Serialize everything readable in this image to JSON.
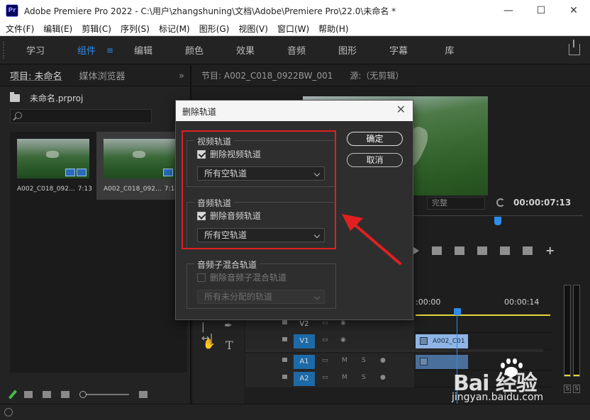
{
  "window": {
    "app_icon": "Pr",
    "title": "Adobe Premiere Pro 2022 - C:\\用户\\zhangshuning\\文档\\Adobe\\Premiere Pro\\22.0\\未命名 *",
    "controls": {
      "minimize": "—",
      "maximize": "☐",
      "close": "✕"
    }
  },
  "menubar": {
    "items": [
      "文件(F)",
      "编辑(E)",
      "剪辑(C)",
      "序列(S)",
      "标记(M)",
      "图形(G)",
      "视图(V)",
      "窗口(W)",
      "帮助(H)"
    ]
  },
  "workspaces": {
    "tabs": [
      "学习",
      "组件",
      "编辑",
      "颜色",
      "效果",
      "音频",
      "图形",
      "字幕",
      "库"
    ],
    "active": "组件",
    "menu_icon": "≡"
  },
  "project_panel": {
    "tabs": [
      "项目: 未命名",
      "媒体浏览器"
    ],
    "more": "»",
    "project_file": "未命名.prproj",
    "clips": [
      {
        "name": "A002_C018_092...",
        "duration": "7:13"
      },
      {
        "name": "A002_C018_092...",
        "duration": "7:13"
      }
    ]
  },
  "program_monitor": {
    "tabs": [
      "节目: A002_C018_0922BW_001",
      "源:（无剪辑）"
    ],
    "fit": "完整",
    "timecode": "00:00:07:13",
    "add_button": "+"
  },
  "tools": {
    "glyphs": {
      "track_select": "|↔|",
      "pen": "✒",
      "hand": "✋",
      "type": "T"
    }
  },
  "timeline": {
    "time_start": ":00:00",
    "time_end": "00:00:14",
    "tracks": [
      {
        "label": "V2",
        "target": false,
        "kind": "video",
        "clip": ""
      },
      {
        "label": "V1",
        "target": true,
        "kind": "video",
        "clip": "A002_C01"
      },
      {
        "label": "A1",
        "target": true,
        "kind": "audio",
        "clip": ""
      },
      {
        "label": "A2",
        "target": true,
        "kind": "audio",
        "clip": ""
      }
    ],
    "audio_controls": {
      "mute": "M",
      "solo": "S"
    }
  },
  "meters": {
    "solo_labels": [
      "S",
      "S"
    ]
  },
  "dialog": {
    "title": "删除轨道",
    "close": "✕",
    "video_group": {
      "legend": "视频轨道",
      "checkbox_label": "删除视频轨道",
      "checked": true,
      "select_value": "所有空轨道"
    },
    "audio_group": {
      "legend": "音频轨道",
      "checkbox_label": "删除音频轨道",
      "checked": true,
      "select_value": "所有空轨道"
    },
    "submix_group": {
      "legend": "音频子混合轨道",
      "checkbox_label": "删除音频子混合轨道",
      "checked": false,
      "disabled": true,
      "select_value": "所有未分配的轨道"
    },
    "ok_label": "确定",
    "cancel_label": "取消"
  },
  "annotation": {
    "highlight_color": "#e02020",
    "arrow_color": "#e02020"
  },
  "watermark": {
    "brand": "Bai  经验",
    "url": "jingyan.baidu.com"
  },
  "colors": {
    "accent": "#2d8ceb",
    "work_area": "#e6d83a",
    "video_clip": "#8fb5e6",
    "target_track": "#1d6aa8"
  }
}
